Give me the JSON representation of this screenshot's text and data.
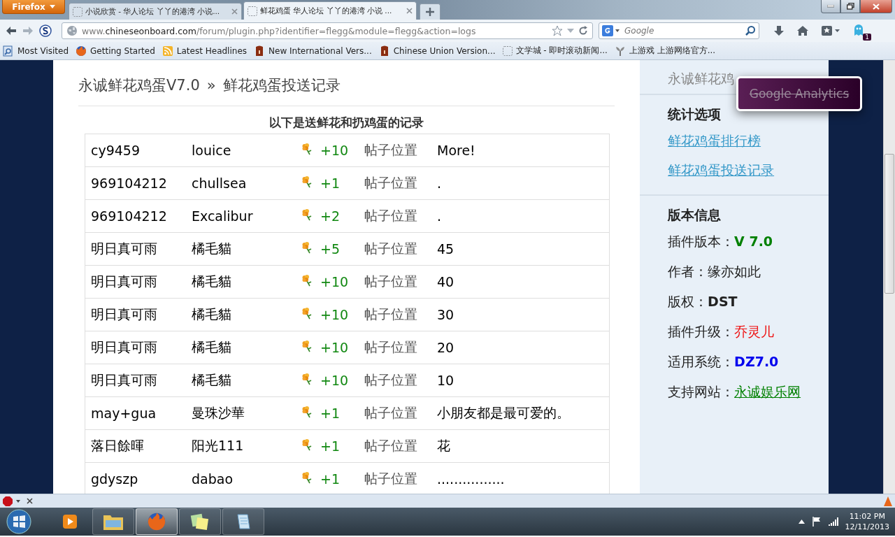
{
  "browser": {
    "menu_button": "Firefox",
    "tabs": [
      {
        "title": "小说欣赏 - 华人论坛 丫丫的港湾 小说...",
        "selected": false
      },
      {
        "title": "鲜花鸡蛋 华人论坛 丫丫的港湾 小说 ...",
        "selected": true
      }
    ],
    "url": {
      "prefix": "www.",
      "domain": "chineseonboard.com",
      "path": "/forum/plugin.php?identifier=flegg&module=flegg&action=logs"
    },
    "search": {
      "placeholder": "Google"
    },
    "addon_badge": "1",
    "bookmarks": [
      {
        "label": "Most Visited",
        "kind": "search"
      },
      {
        "label": "Getting Started",
        "kind": "firefox"
      },
      {
        "label": "Latest Headlines",
        "kind": "rss"
      },
      {
        "label": "New International Vers...",
        "kind": "book"
      },
      {
        "label": "Chinese Union Version...",
        "kind": "book"
      },
      {
        "label": "文学城 - 即时滚动新闻...",
        "kind": "blank"
      },
      {
        "label": "上游戏 上游网络官方...",
        "kind": "sprout"
      }
    ]
  },
  "page": {
    "breadcrumb": [
      "永诚鲜花鸡蛋V7.0",
      "鲜花鸡蛋投送记录"
    ],
    "breadcrumb_separator": "»",
    "caption": "以下是送鲜花和扔鸡蛋的记录",
    "rows": [
      {
        "sender": "cy9459",
        "receiver": "louice",
        "amount": "+10",
        "post": "帖子位置",
        "message": "More!"
      },
      {
        "sender": "969104212",
        "receiver": "chullsea",
        "amount": "+1",
        "post": "帖子位置",
        "message": "."
      },
      {
        "sender": "969104212",
        "receiver": "Excalibur",
        "amount": "+2",
        "post": "帖子位置",
        "message": "."
      },
      {
        "sender": "明日真可雨",
        "receiver": "橘毛貓",
        "amount": "+5",
        "post": "帖子位置",
        "message": "45"
      },
      {
        "sender": "明日真可雨",
        "receiver": "橘毛貓",
        "amount": "+10",
        "post": "帖子位置",
        "message": "40"
      },
      {
        "sender": "明日真可雨",
        "receiver": "橘毛貓",
        "amount": "+10",
        "post": "帖子位置",
        "message": "30"
      },
      {
        "sender": "明日真可雨",
        "receiver": "橘毛貓",
        "amount": "+10",
        "post": "帖子位置",
        "message": "20"
      },
      {
        "sender": "明日真可雨",
        "receiver": "橘毛貓",
        "amount": "+10",
        "post": "帖子位置",
        "message": "10"
      },
      {
        "sender": "may+gua",
        "receiver": "曼珠沙華",
        "amount": "+1",
        "post": "帖子位置",
        "message": "小朋友都是最可爱的。"
      },
      {
        "sender": "落日餘暉",
        "receiver": "阳光111",
        "amount": "+1",
        "post": "帖子位置",
        "message": "花"
      },
      {
        "sender": "gdyszp",
        "receiver": "dabao",
        "amount": "+1",
        "post": "帖子位置",
        "message": "................"
      }
    ]
  },
  "sidebar": {
    "title": "永诚鲜花鸡",
    "stats_heading": "统计选项",
    "links": [
      "鲜花鸡蛋排行榜",
      "鲜花鸡蛋投送记录"
    ],
    "info_heading": "版本信息",
    "info": [
      {
        "label": "插件版本：",
        "value": "V 7.0",
        "kind": "bold",
        "color": "#008000"
      },
      {
        "label": "作者：",
        "value": "缘亦如此",
        "kind": "plain",
        "color": "#222222"
      },
      {
        "label": "版权：",
        "value": "DST",
        "kind": "bold",
        "color": "#222222"
      },
      {
        "label": "插件升级：",
        "value": "乔灵儿",
        "kind": "plain",
        "color": "#ee1111"
      },
      {
        "label": "适用系统：",
        "value": "DZ7.0",
        "kind": "bold",
        "color": "#0000ee"
      },
      {
        "label": "支持网站：",
        "value": "永诚娱乐网",
        "kind": "link",
        "color": "#008000"
      }
    ]
  },
  "popup": {
    "text": "Google Analytics"
  },
  "taskbar": {
    "apps": [
      {
        "kind": "media",
        "selected": false
      },
      {
        "kind": "folder",
        "selected": false
      },
      {
        "kind": "firefox",
        "selected": true
      },
      {
        "kind": "notes",
        "selected": false
      },
      {
        "kind": "paper",
        "selected": false
      }
    ],
    "time": "11:02 PM",
    "date": "12/11/2013"
  }
}
